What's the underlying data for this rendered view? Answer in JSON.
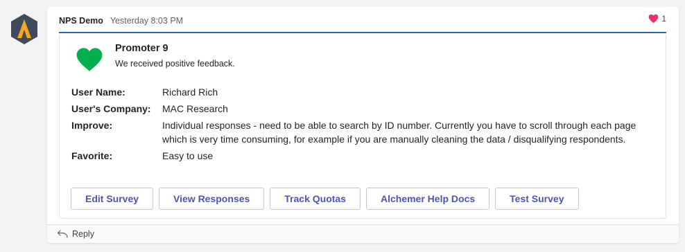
{
  "message": {
    "sender": "NPS Demo",
    "timestamp": "Yesterday 8:03 PM",
    "reaction_count": "1"
  },
  "card": {
    "title": "Promoter 9",
    "subtitle": "We received positive feedback.",
    "facts": [
      {
        "key": "User Name:",
        "value": "Richard Rich"
      },
      {
        "key": "User's Company:",
        "value": "MAC Research"
      },
      {
        "key": "Improve:",
        "value": "Individual responses - need to be able to search by ID number. Currently you have to scroll through each page which is very time consuming, for example if you are manually cleaning the data / disqualifying respondents."
      },
      {
        "key": "Favorite:",
        "value": "Easy to use"
      }
    ],
    "actions": [
      "Edit Survey",
      "View Responses",
      "Track Quotas",
      "Alchemer Help Docs",
      "Test Survey"
    ]
  },
  "reply_label": "Reply",
  "colors": {
    "accent_rule": "#2866b0",
    "button_text": "#4b53bc",
    "heart_green": "#00b050",
    "reaction_heart": "#e8336e",
    "avatar_bg": "#3f4a5a",
    "avatar_mark": "#f5a623"
  },
  "icons": {
    "avatar": "alchemer-logo-icon",
    "reaction": "heart-reaction-icon",
    "card": "green-heart-icon",
    "reply": "reply-arrow-icon"
  }
}
